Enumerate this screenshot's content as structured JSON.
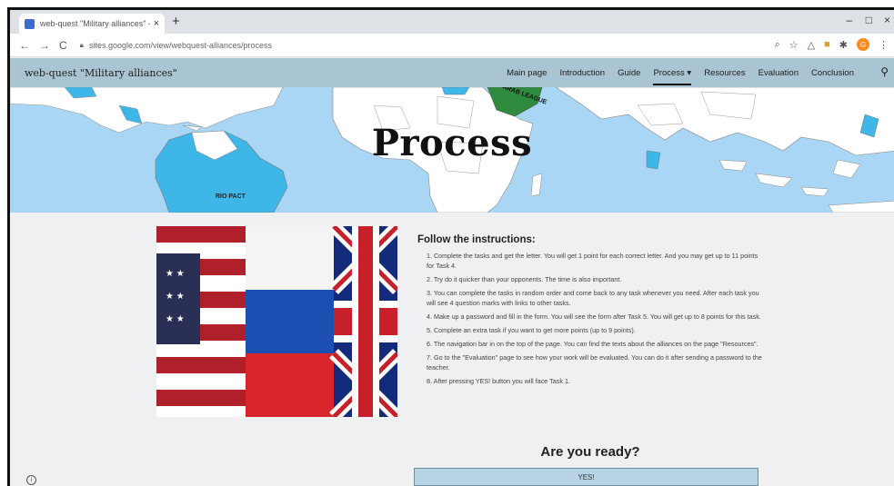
{
  "browser": {
    "tab_title": "web-quest \"Military alliances\" - G",
    "tab_close": "×",
    "new_tab": "+",
    "url": "sites.google.com/view/webquest-alliances/process",
    "back": "←",
    "forward": "→",
    "reload": "C",
    "minimize": "–",
    "maximize": "□",
    "close": "×",
    "profile_initial": "G"
  },
  "site": {
    "title": "web-quest \"Military alliances\"",
    "nav": [
      "Main page",
      "Introduction",
      "Guide",
      "Process",
      "Resources",
      "Evaluation",
      "Conclusion"
    ],
    "active_nav": "Process",
    "process_chevron": "▾"
  },
  "hero": {
    "title": "Process",
    "map_label_left": "RIO PACT",
    "map_label_right": "ARAB LEAGUE"
  },
  "instructions": {
    "heading": "Follow the instructions:",
    "items": [
      "1. Complete the tasks and get the letter. You will get 1 point for each correct letter. And you may get up to 11 points for Task 4.",
      "2. Try do it quicker than your opponents. The time is also important.",
      "3. You can complete the tasks in random order and come back to any task whenever you need. After each task you will see 4 question marks with links to other tasks.",
      "4. Make up a password and fill in the form. You will see the form after Task 5. You will get up to 8 points for this task.",
      "5. Complete an extra task if you want to get more points (up to 9 points).",
      "6. The navigation bar in on the top of the page. You can find the texts about the alliances on the page \"Resources\".",
      "7. Go to the \"Evaluation\" page to see how your work will be evaluated. You can do it after sending a password to the teacher.",
      "8. After pressing YES! button you will face Task 1."
    ]
  },
  "ready_text": "Are you ready?",
  "yes_button": "YES!"
}
